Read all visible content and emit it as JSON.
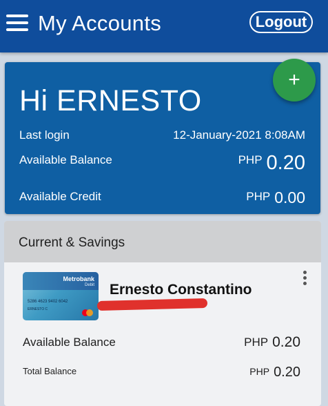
{
  "header": {
    "title": "My Accounts",
    "logout_label": "Logout",
    "menu_icon": "hamburger-menu-icon"
  },
  "greeting_card": {
    "greeting": "Hi ERNESTO",
    "fab_label": "+",
    "last_login_label": "Last login",
    "last_login_value": "12-January-2021 8:08AM",
    "available_balance_label": "Available Balance",
    "available_balance_currency": "PHP",
    "available_balance_amount": "0.20",
    "available_credit_label": "Available Credit",
    "available_credit_currency": "PHP",
    "available_credit_amount": "0.00"
  },
  "accounts_section": {
    "title": "Current & Savings",
    "account": {
      "owner_name": "Ernesto Constantino",
      "card_brand": "Metrobank",
      "card_type": "Debit",
      "card_number": "5286 4623 9402 6042",
      "card_holder": "ERNESTO C",
      "available_balance_label": "Available Balance",
      "available_balance_currency": "PHP",
      "available_balance_amount": "0.20",
      "total_balance_label": "Total Balance",
      "total_balance_currency": "PHP",
      "total_balance_amount": "0.20"
    }
  },
  "colors": {
    "header_bg": "#0f4d9c",
    "card_bg": "#0f5fa3",
    "fab_bg": "#2d9a4a",
    "page_bg": "#cfd8e3",
    "redaction": "#e0312c"
  }
}
